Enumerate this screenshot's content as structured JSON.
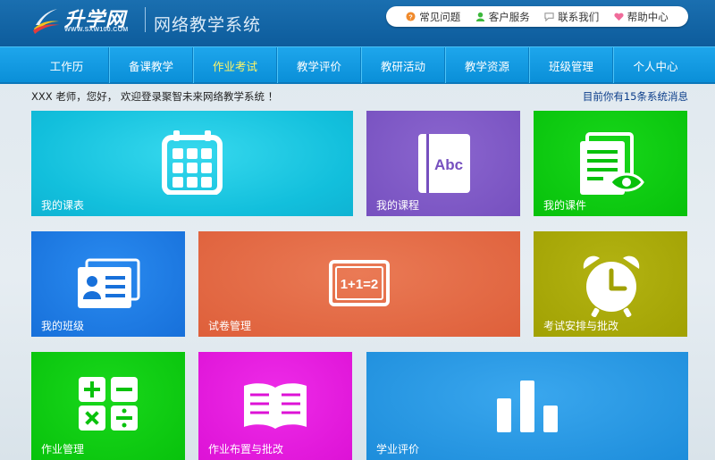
{
  "header": {
    "logo_text": "升学网",
    "logo_url": "WWW.SXW100.COM",
    "system_name": "网络教学系统",
    "top_links": [
      {
        "label": "常见问题",
        "icon": "question-icon",
        "color": "#f08a2c"
      },
      {
        "label": "客户服务",
        "icon": "service-icon",
        "color": "#3cb83c"
      },
      {
        "label": "联系我们",
        "icon": "contact-icon",
        "color": "#aaaaaa"
      },
      {
        "label": "帮助中心",
        "icon": "heart-icon",
        "color": "#f06b9a"
      }
    ]
  },
  "nav": {
    "items": [
      {
        "label": "工作历"
      },
      {
        "label": "备课教学"
      },
      {
        "label": "作业考试"
      },
      {
        "label": "教学评价"
      },
      {
        "label": "教研活动"
      },
      {
        "label": "教学资源"
      },
      {
        "label": "班级管理"
      },
      {
        "label": "个人中心"
      }
    ],
    "active_color": "#fff566"
  },
  "welcome": {
    "text": "XXX 老师，您好， 欢迎登录聚智未来网络教学系统 ！",
    "messages": "目前你有15条系统消息"
  },
  "tiles": {
    "schedule": {
      "label": "我的课表",
      "icon": "calendar-icon"
    },
    "course": {
      "label": "我的课程",
      "icon": "book-abc-icon",
      "icon_text": "Abc"
    },
    "courseware": {
      "label": "我的课件",
      "icon": "document-eye-icon"
    },
    "class": {
      "label": "我的班级",
      "icon": "id-card-icon"
    },
    "exam": {
      "label": "试卷管理",
      "icon": "blackboard-icon",
      "icon_text": "1+1=2"
    },
    "arrange": {
      "label": "考试安排与批改",
      "icon": "alarm-clock-icon"
    },
    "homework": {
      "label": "作业管理",
      "icon": "calculator-icon"
    },
    "assign": {
      "label": "作业布置与批改",
      "icon": "open-book-icon"
    },
    "evaluation": {
      "label": "学业评价",
      "icon": "bar-chart-icon"
    }
  }
}
